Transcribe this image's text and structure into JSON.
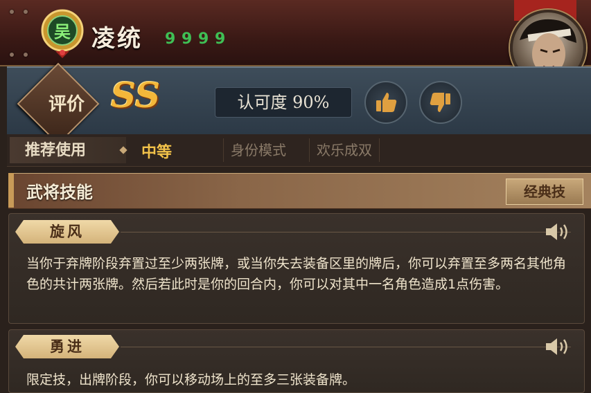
{
  "hero": {
    "faction_char": "吴",
    "name": "凌统",
    "magatama_count": 4,
    "magatama_glyph": "9"
  },
  "rating": {
    "eval_label": "评价",
    "grade": "SS",
    "approval_text": "认可度 90%"
  },
  "recommend": {
    "label": "推荐使用",
    "value": "中等",
    "modes": [
      "身份模式",
      "欢乐成双"
    ]
  },
  "skills_section": {
    "title": "武将技能",
    "classic_button": "经典技"
  },
  "skills": [
    {
      "name": "旋风",
      "desc": "当你于弃牌阶段弃置过至少两张牌，或当你失去装备区里的牌后，你可以弃置至多两名其他角色的共计两张牌。然后若此时是你的回合内，你可以对其中一名角色造成1点伤害。"
    },
    {
      "name": "勇进",
      "desc": "限定技，出牌阶段，你可以移动场上的至多三张装备牌。"
    }
  ],
  "colors": {
    "faction_green": "#3fbf55",
    "grade_gold": "#f3b73a",
    "recommend_gold": "#f2c24a"
  },
  "icons": [
    "faction-wu-badge-icon",
    "magatama-icon",
    "thumbs-up-icon",
    "thumbs-down-icon",
    "speaker-icon"
  ]
}
